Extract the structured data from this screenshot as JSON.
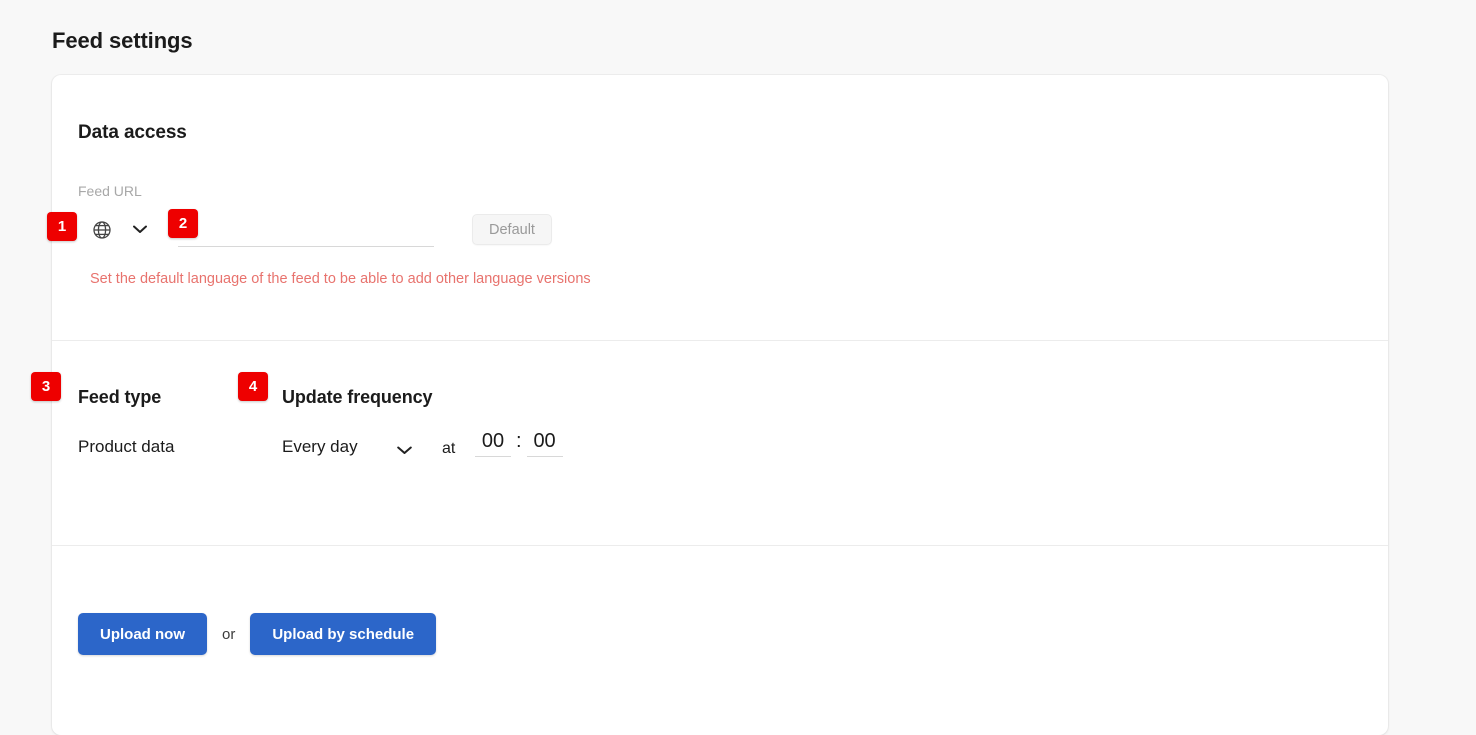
{
  "page": {
    "title": "Feed settings",
    "background_color": "#f8f8f8",
    "accent_color": "#2c66c9",
    "badge_color": "#ee0000",
    "error_color": "#e8736e"
  },
  "card": {
    "data_access": {
      "heading": "Data access",
      "feed_url": {
        "label": "Feed URL",
        "value": "",
        "placeholder": "",
        "language_icon": "globe-icon",
        "language_chevron_icon": "chevron-down-icon"
      },
      "default_button": "Default",
      "error_message": "Set the default language of the feed to be able to add other language versions"
    },
    "feed_type": {
      "heading": "Feed type",
      "value": "Product data"
    },
    "update_frequency": {
      "heading": "Update frequency",
      "frequency_value": "Every day",
      "frequency_chevron_icon": "chevron-down-icon",
      "at_label": "at",
      "time_hours": "00",
      "time_separator": ":",
      "time_minutes": "00"
    },
    "footer": {
      "upload_now": "Upload now",
      "or_label": "or",
      "upload_by_schedule": "Upload by schedule"
    }
  },
  "annotations": {
    "badge_1": "1",
    "badge_2": "2",
    "badge_3": "3",
    "badge_4": "4"
  }
}
